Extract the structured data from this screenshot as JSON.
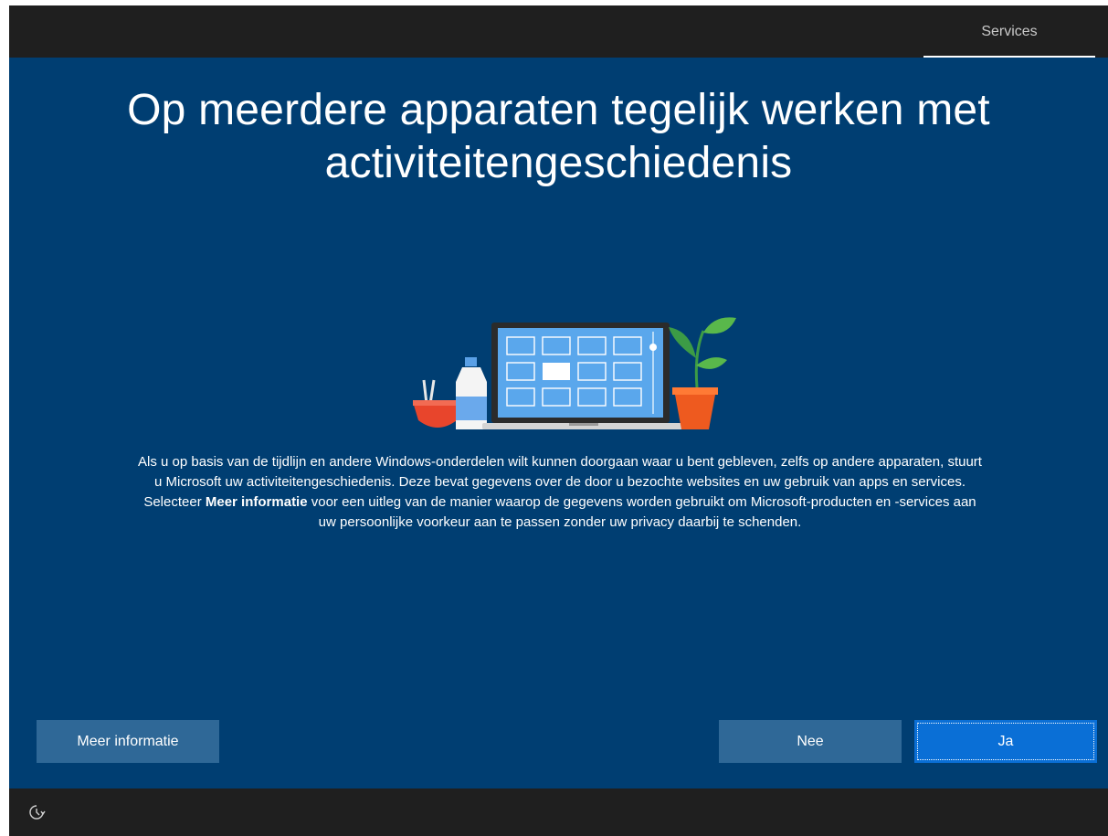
{
  "topbar": {
    "tab_label": "Services"
  },
  "title": {
    "line1": "Op meerdere apparaten tegelijk werken met",
    "line2": "activiteitengeschiedenis"
  },
  "description": {
    "line1": "Als u op basis van de tijdlijn en andere Windows-onderdelen wilt kunnen doorgaan waar u bent gebleven, zelfs op andere apparaten, stuurt",
    "line2": "u Microsoft uw activiteitengeschiedenis. Deze bevat gegevens over de door u bezochte websites en uw gebruik van apps en services.",
    "line3_prefix": "Selecteer ",
    "line3_bold": "Meer informatie",
    "line3_suffix": " voor een uitleg van de manier waarop de gegevens worden gebruikt om Microsoft-producten en -services aan",
    "line4": "uw persoonlijke voorkeur aan te passen zonder uw privacy daarbij te schenden."
  },
  "buttons": {
    "more_info": "Meer informatie",
    "no": "Nee",
    "yes": "Ja"
  },
  "icons": {
    "ease_of_access": "ease-of-access-icon"
  },
  "colors": {
    "background": "#003e72",
    "bar": "#1f1f1f",
    "secondary_button": "#2f6897",
    "primary_button": "#0a6fd6"
  }
}
